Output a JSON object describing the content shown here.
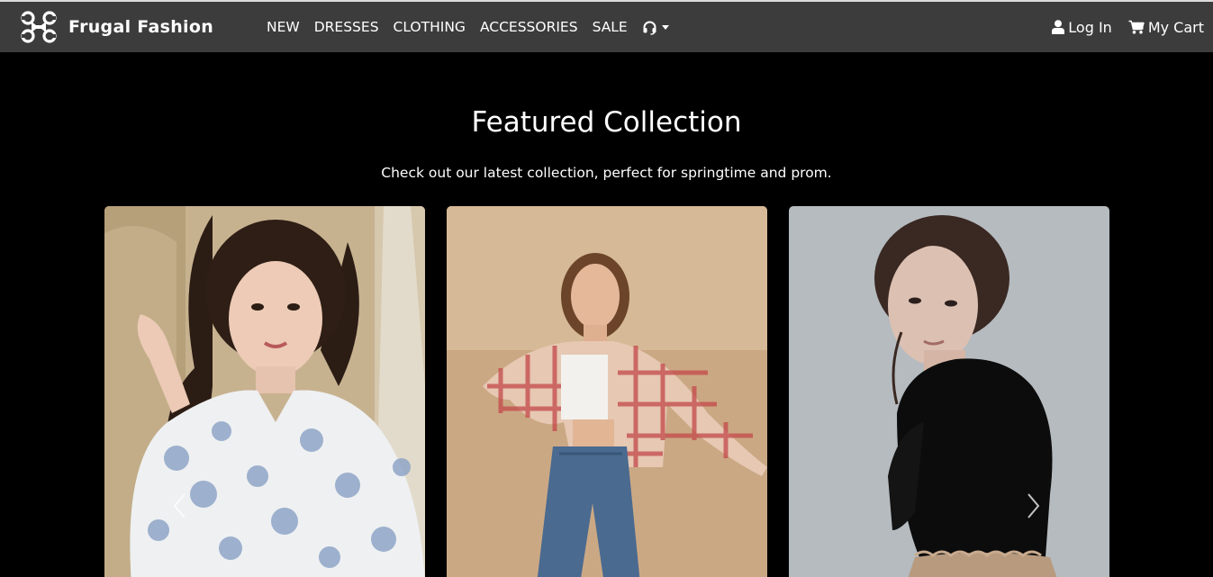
{
  "brand": {
    "name": "Frugal Fashion",
    "icon": "drone-logo-icon"
  },
  "nav": {
    "links": [
      "NEW",
      "DRESSES",
      "CLOTHING",
      "ACCESSORIES",
      "SALE"
    ],
    "support_icon": "headset-icon"
  },
  "account": {
    "login_label": "Log In",
    "cart_label": "My Cart"
  },
  "hero": {
    "title": "Featured Collection",
    "subtitle": "Check out our latest collection, perfect for springtime and prom."
  },
  "carousel": {
    "prev_icon": "chevron-left-icon",
    "next_icon": "chevron-right-icon"
  },
  "colors": {
    "navbar": "#3d3c3d",
    "page": "#000000",
    "text": "#ffffff"
  }
}
